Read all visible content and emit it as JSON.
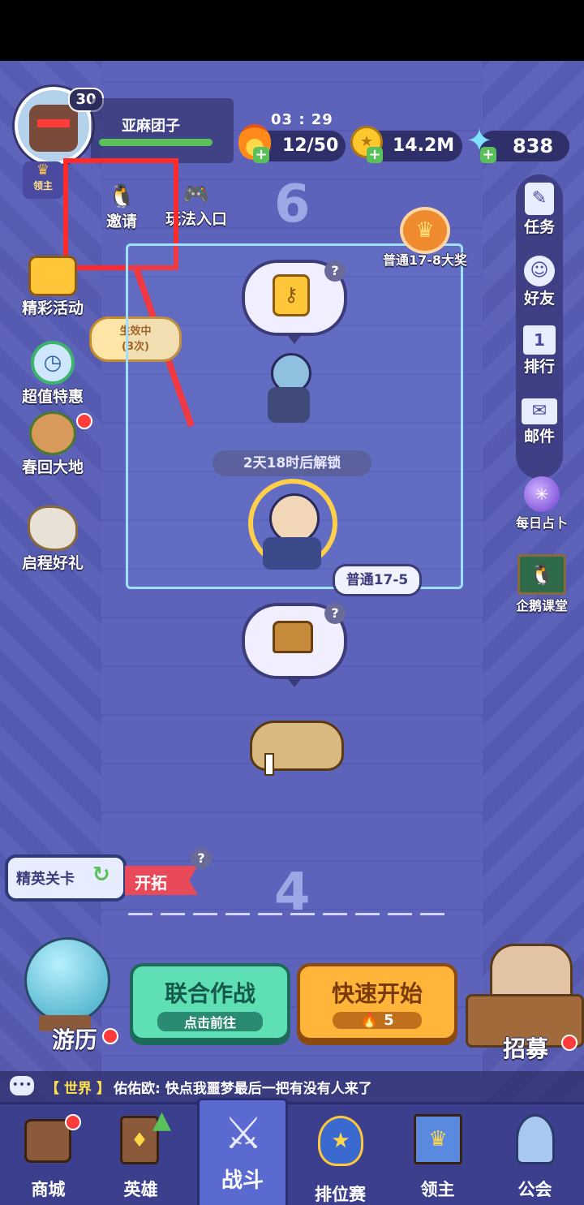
{
  "player": {
    "level": "30",
    "name": "亚麻团子",
    "title_badge": "领主"
  },
  "timer": "03 : 29",
  "resources": {
    "stamina": "12/50",
    "gold": "14.2M",
    "gems": "838"
  },
  "top_left": {
    "invite": "邀请",
    "gameplay_entry": "玩法入口"
  },
  "left_menu": [
    {
      "label": "精彩活动",
      "icon": "event-icon"
    },
    {
      "label": "超值特惠",
      "icon": "clock-icon"
    },
    {
      "label": "春回大地",
      "icon": "monkey-icon"
    },
    {
      "label": "启程好礼",
      "icon": "bird-icon"
    }
  ],
  "buff_badge": {
    "line1": "生效中",
    "line2": "(3次)"
  },
  "right_menu": [
    {
      "label": "任务",
      "icon": "task-icon"
    },
    {
      "label": "好友",
      "icon": "friend-icon"
    },
    {
      "label": "排行",
      "icon": "rank-icon"
    },
    {
      "label": "邮件",
      "icon": "mail-icon"
    },
    {
      "label": "每日占卜",
      "icon": "crystal-ball-icon"
    },
    {
      "label": "企鹅课堂",
      "icon": "penguin-icon"
    }
  ],
  "stage": {
    "chapter_top": "6",
    "chapter_bottom": "4",
    "big_reward": "普通17-8大奖",
    "unlock_time": "2天18时后解锁",
    "current_stage": "普通17-5",
    "question": "?"
  },
  "elite": {
    "label": "精英关卡",
    "action": "开拓"
  },
  "actions": {
    "coop": {
      "title": "联合作战",
      "sub": "点击前往"
    },
    "quick": {
      "title": "快速开始",
      "cost": "5"
    },
    "travel": "游历",
    "recruit": "招募"
  },
  "chat": {
    "channel": "【 世界 】",
    "message": "佑佑欧: 快点我噩梦最后一把有没有人来了"
  },
  "nav": [
    {
      "label": "商城",
      "icon": "shop-icon"
    },
    {
      "label": "英雄",
      "icon": "hero-card-icon"
    },
    {
      "label": "战斗",
      "icon": "battle-icon"
    },
    {
      "label": "排位赛",
      "icon": "ranked-icon"
    },
    {
      "label": "领主",
      "icon": "lord-banner-icon"
    },
    {
      "label": "公会",
      "icon": "guild-icon"
    }
  ],
  "colors": {
    "highlight_box": "#ff2a2a",
    "coop_button": "#5fe0b4",
    "quick_button": "#ffb43a",
    "accent_green": "#5ac05a"
  }
}
